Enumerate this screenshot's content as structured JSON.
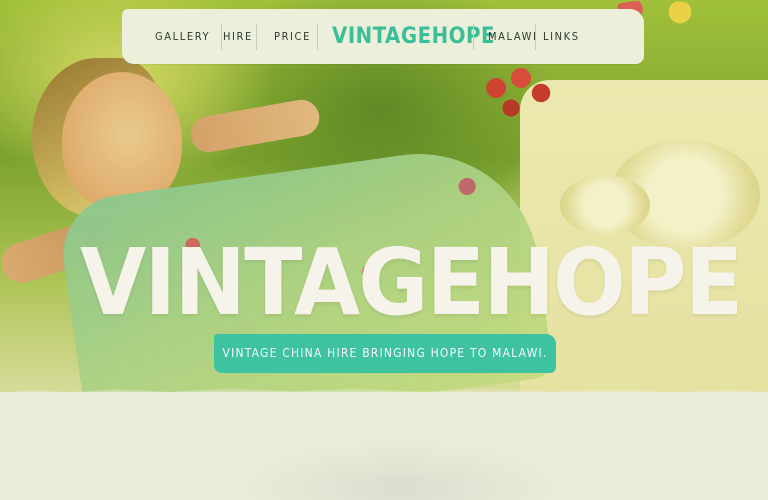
{
  "nav": {
    "items_left": [
      "GALLERY",
      "HIRE",
      "PRICE"
    ],
    "logo": "VINTAGEHOPE",
    "items_right": [
      "MALAWI",
      "LINKS"
    ]
  },
  "hero": {
    "title": "VINTAGEHOPE",
    "tagline": "VINTAGE CHINA HIRE BRINGING HOPE TO MALAWI."
  },
  "colors": {
    "accent": "#3fc2a0",
    "nav_bg": "#ecefda",
    "page_bg": "#e9edd8",
    "title_text": "#f6f4ea"
  }
}
